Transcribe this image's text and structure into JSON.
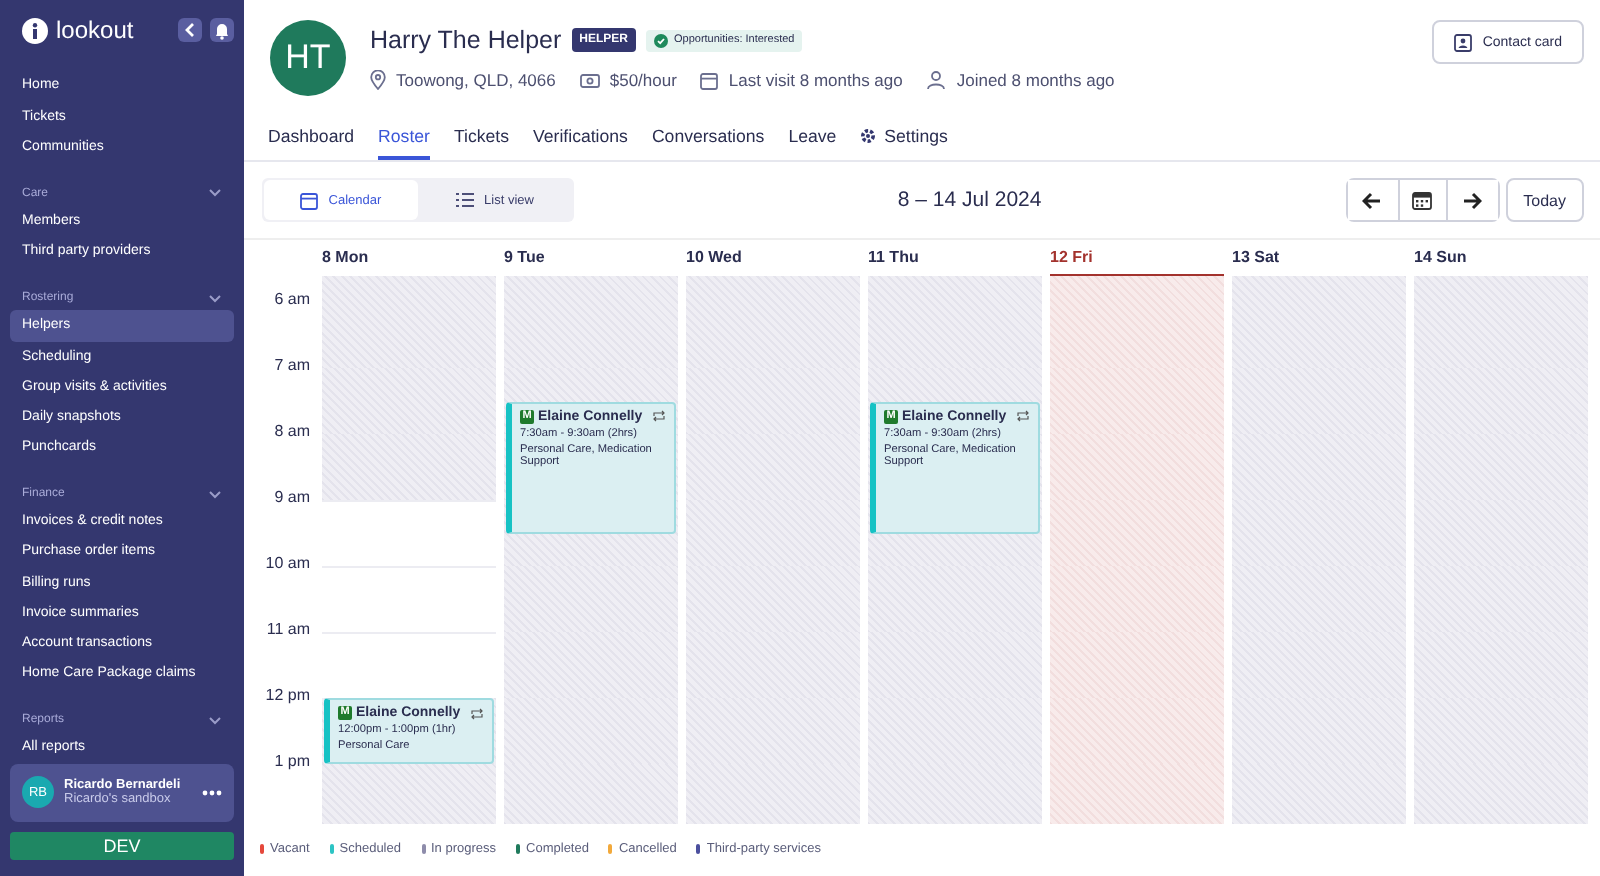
{
  "sidebar": {
    "brand": "lookout",
    "sections": [
      {
        "items": [
          {
            "label": "Home",
            "selected": false
          },
          {
            "label": "Tickets",
            "selected": false
          },
          {
            "label": "Communities",
            "selected": false
          }
        ]
      },
      {
        "heading": "Care",
        "expanded": true,
        "items": [
          {
            "label": "Members",
            "selected": false
          },
          {
            "label": "Third party providers",
            "selected": false
          }
        ]
      },
      {
        "heading": "Rostering",
        "expanded": true,
        "items": [
          {
            "label": "Helpers",
            "selected": true
          },
          {
            "label": "Scheduling",
            "selected": false
          },
          {
            "label": "Group visits & activities",
            "selected": false
          },
          {
            "label": "Daily snapshots",
            "selected": false
          },
          {
            "label": "Punchcards",
            "selected": false
          }
        ]
      },
      {
        "heading": "Finance",
        "expanded": true,
        "items": [
          {
            "label": "Invoices & credit notes",
            "selected": false
          },
          {
            "label": "Purchase order items",
            "selected": false
          },
          {
            "label": "Billing runs",
            "selected": false
          },
          {
            "label": "Invoice summaries",
            "selected": false
          },
          {
            "label": "Account transactions",
            "selected": false
          },
          {
            "label": "Home Care Package claims",
            "selected": false
          }
        ]
      },
      {
        "heading": "Reports",
        "expanded": true,
        "items": [
          {
            "label": "All reports",
            "selected": false
          }
        ]
      }
    ],
    "user": {
      "initials": "RB",
      "name": "Ricardo Bernardeli",
      "workspace": "Ricardo's sandbox"
    },
    "environment": "DEV"
  },
  "profile": {
    "initials": "HT",
    "name": "Harry The Helper",
    "role_badge": "HELPER",
    "status_badge": "Opportunities: Interested",
    "location": "Toowong, QLD, 4066",
    "rate": "$50/hour",
    "last_visit": "Last visit 8 months ago",
    "joined": "Joined 8 months ago",
    "contact_button": "Contact card"
  },
  "tabs": [
    {
      "label": "Dashboard",
      "selected": false
    },
    {
      "label": "Roster",
      "selected": true
    },
    {
      "label": "Tickets",
      "selected": false
    },
    {
      "label": "Verifications",
      "selected": false
    },
    {
      "label": "Conversations",
      "selected": false
    },
    {
      "label": "Leave",
      "selected": false
    },
    {
      "label": "Settings",
      "selected": false
    }
  ],
  "view_toggle": [
    {
      "label": "Calendar",
      "selected": true
    },
    {
      "label": "List view",
      "selected": false
    }
  ],
  "date_range": "8 – 14 Jul 2024",
  "today_button": "Today",
  "time_labels": [
    "6 am",
    "7 am",
    "8 am",
    "9 am",
    "10 am",
    "11 am",
    "12 pm",
    "1 pm"
  ],
  "days": [
    {
      "label": "8 Mon",
      "today": false,
      "available": [
        false,
        false,
        false,
        true,
        true,
        true,
        false,
        false
      ],
      "events": [
        {
          "badge": "M",
          "name": "Elaine Connelly",
          "time": "12:00pm - 1:00pm (1hr)",
          "services": "Personal Care",
          "recurring": true
        }
      ]
    },
    {
      "label": "9 Tue",
      "today": false,
      "available": [
        false,
        false,
        false,
        false,
        false,
        false,
        false,
        false
      ],
      "events": [
        {
          "badge": "M",
          "name": "Elaine Connelly",
          "time": "7:30am - 9:30am (2hrs)",
          "services": "Personal Care, Medication Support",
          "recurring": true
        }
      ]
    },
    {
      "label": "10 Wed",
      "today": false,
      "available": [
        false,
        false,
        false,
        false,
        false,
        false,
        false,
        false
      ]
    },
    {
      "label": "11 Thu",
      "today": false,
      "available": [
        false,
        false,
        false,
        false,
        false,
        false,
        false,
        false
      ],
      "events": [
        {
          "badge": "M",
          "name": "Elaine Connelly",
          "time": "7:30am - 9:30am (2hrs)",
          "services": "Personal Care, Medication Support",
          "recurring": true
        }
      ]
    },
    {
      "label": "12 Fri",
      "today": true,
      "available": [
        false,
        false,
        false,
        false,
        false,
        false,
        false,
        false
      ]
    },
    {
      "label": "13 Sat",
      "today": false,
      "available": [
        false,
        false,
        false,
        false,
        false,
        false,
        false,
        false
      ]
    },
    {
      "label": "14 Sun",
      "today": false,
      "available": [
        false,
        false,
        false,
        false,
        false,
        false,
        false,
        false
      ]
    }
  ],
  "legend": [
    {
      "label": "Vacant",
      "color": "#e5483b"
    },
    {
      "label": "Scheduled",
      "color": "#2cc4c4"
    },
    {
      "label": "In progress",
      "color": "#8e8cab"
    },
    {
      "label": "Completed",
      "color": "#1f7a5c"
    },
    {
      "label": "Cancelled",
      "color": "#f2a93b"
    },
    {
      "label": "Third-party services",
      "color": "#4b4f9e"
    }
  ]
}
